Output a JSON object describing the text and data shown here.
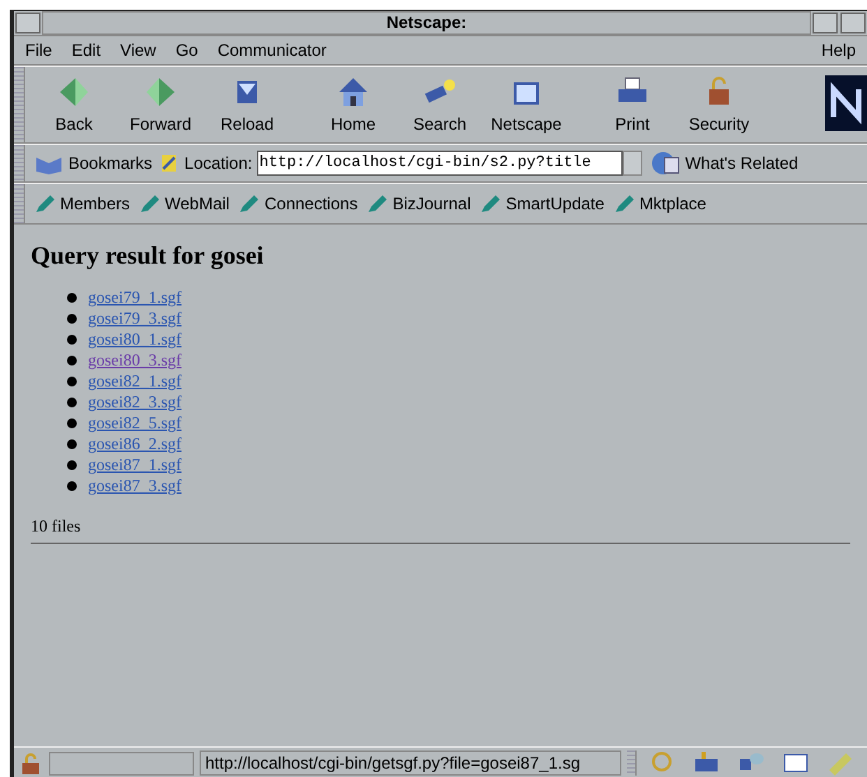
{
  "window": {
    "title": "Netscape:"
  },
  "menu": {
    "items": [
      "File",
      "Edit",
      "View",
      "Go",
      "Communicator"
    ],
    "help": "Help"
  },
  "toolbar": [
    {
      "label": "Back",
      "kind": "back"
    },
    {
      "label": "Forward",
      "kind": "forward"
    },
    {
      "label": "Reload",
      "kind": "reload"
    },
    {
      "label": "Home",
      "kind": "home"
    },
    {
      "label": "Search",
      "kind": "search"
    },
    {
      "label": "Netscape",
      "kind": "my"
    },
    {
      "label": "Print",
      "kind": "print"
    },
    {
      "label": "Security",
      "kind": "lock"
    }
  ],
  "location_bar": {
    "bookmarks": "Bookmarks",
    "location_label": "Location:",
    "url": "http://localhost/cgi-bin/s2.py?title",
    "related": "What's Related"
  },
  "personal_bar": [
    "Members",
    "WebMail",
    "Connections",
    "BizJournal",
    "SmartUpdate",
    "Mktplace"
  ],
  "content": {
    "heading": "Query result for gosei",
    "links": [
      {
        "text": "gosei79_1.sgf",
        "visited": false
      },
      {
        "text": "gosei79_3.sgf",
        "visited": false
      },
      {
        "text": "gosei80_1.sgf",
        "visited": false
      },
      {
        "text": "gosei80_3.sgf",
        "visited": true
      },
      {
        "text": "gosei82_1.sgf",
        "visited": false
      },
      {
        "text": "gosei82_3.sgf",
        "visited": false
      },
      {
        "text": "gosei82_5.sgf",
        "visited": false
      },
      {
        "text": "gosei86_2.sgf",
        "visited": false
      },
      {
        "text": "gosei87_1.sgf",
        "visited": false
      },
      {
        "text": "gosei87_3.sgf",
        "visited": false
      }
    ],
    "footer": "10 files"
  },
  "status_bar": {
    "message": "http://localhost/cgi-bin/getsgf.py?file=gosei87_1.sg"
  }
}
